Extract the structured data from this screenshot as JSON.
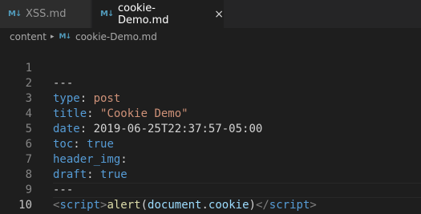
{
  "tabs": [
    {
      "icon": "M↓",
      "label": "XSS.md"
    },
    {
      "icon": "M↓",
      "label": "cookie-Demo.md",
      "close": "×"
    }
  ],
  "breadcrumb": {
    "folder": "content",
    "separator": "▸",
    "file_icon": "M↓",
    "file": "cookie-Demo.md"
  },
  "editor": {
    "line_numbers": [
      "1",
      "2",
      "3",
      "4",
      "5",
      "6",
      "7",
      "8",
      "9",
      "10"
    ],
    "lines": [
      {
        "text": "---"
      },
      {
        "key": "type",
        "colon": ": ",
        "value": "post"
      },
      {
        "key": "title",
        "colon": ": ",
        "value": "\"Cookie Demo\""
      },
      {
        "key": "date",
        "colon": ": ",
        "value": "2019-06-25T22:37:57-05:00"
      },
      {
        "key": "toc",
        "colon": ": ",
        "value": "true"
      },
      {
        "key": "header_img",
        "colon": ":"
      },
      {
        "key": "draft",
        "colon": ": ",
        "value": "true"
      },
      {
        "text": "---"
      },
      {
        "open_lt": "<",
        "open_name": "script",
        "open_gt": ">",
        "fn": "alert",
        "paren_open": "(",
        "obj": "document",
        "dot": ".",
        "prop": "cookie",
        "paren_close": ")",
        "close_lt": "</",
        "close_name": "script",
        "close_gt": ">"
      },
      {
        "text": ""
      }
    ]
  },
  "colors": {
    "background": "#1e1e1e",
    "key": "#569cd6",
    "string": "#ce9178",
    "tag": "#808080",
    "function": "#dcdcaa",
    "variable": "#9cdcfe",
    "markdown_icon": "#519aba"
  }
}
